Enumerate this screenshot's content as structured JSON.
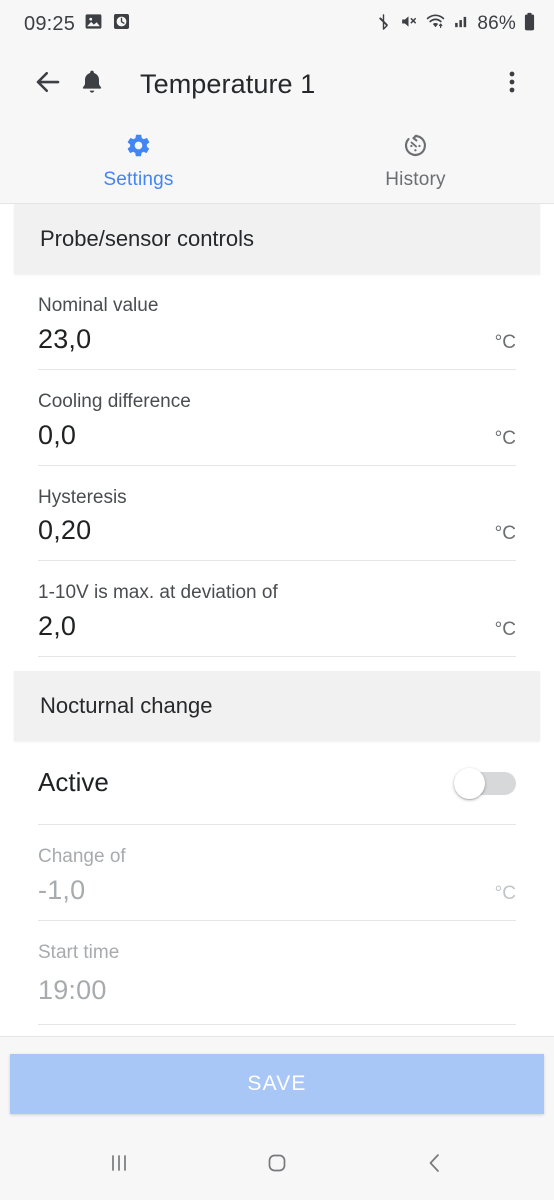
{
  "status_bar": {
    "time": "09:25",
    "battery_percent": "86%",
    "left_icons": [
      "gallery-icon",
      "alarm-icon"
    ],
    "right_icons": [
      "bluetooth-icon",
      "volume-muted-icon",
      "wifi-icon",
      "cellular-signal-icon",
      "battery-icon"
    ]
  },
  "app_bar": {
    "back_icon": "back-arrow-icon",
    "bell_icon": "bell-icon",
    "title": "Temperature 1",
    "overflow_icon": "overflow-menu-icon"
  },
  "tabs": [
    {
      "label": "Settings",
      "icon": "gear-icon",
      "active": true
    },
    {
      "label": "History",
      "icon": "history-icon",
      "active": false
    }
  ],
  "sections": [
    {
      "title": "Probe/sensor controls",
      "fields": [
        {
          "label": "Nominal value",
          "value": "23,0",
          "unit": "°C",
          "disabled": false
        },
        {
          "label": "Cooling difference",
          "value": "0,0",
          "unit": "°C",
          "disabled": false
        },
        {
          "label": "Hysteresis",
          "value": "0,20",
          "unit": "°C",
          "disabled": false
        },
        {
          "label": "1-10V is max. at deviation of",
          "value": "2,0",
          "unit": "°C",
          "disabled": false
        }
      ]
    },
    {
      "title": "Nocturnal change",
      "toggle": {
        "label": "Active",
        "on": false
      },
      "fields": [
        {
          "label": "Change of",
          "value": "-1,0",
          "unit": "°C",
          "disabled": true
        },
        {
          "label": "Start time",
          "value": "19:00",
          "unit": "",
          "disabled": true
        }
      ]
    }
  ],
  "footer": {
    "save_label": "SAVE"
  },
  "nav_bar": {
    "recents_icon": "recents-icon",
    "home_icon": "home-icon",
    "back_icon": "back-chevron-icon"
  },
  "colors": {
    "accent": "#4285f4",
    "save_button": "#a8c7f7",
    "section_header_bg": "#f1f1f1",
    "chrome_bg": "#f7f7f7"
  }
}
